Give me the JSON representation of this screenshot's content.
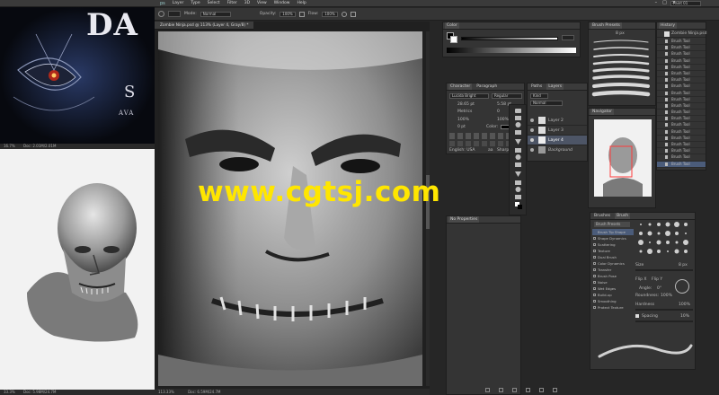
{
  "menubar": {
    "app_mark": "ps",
    "items": [
      "Layer",
      "Type",
      "Select",
      "Filter",
      "3D",
      "View",
      "Window",
      "Help"
    ],
    "workspace": "Paint 01"
  },
  "options": {
    "mode_label": "Mode:",
    "mode_value": "Normal",
    "opacity_label": "Opacity:",
    "opacity_value": "100%",
    "flow_label": "Flow:",
    "flow_value": "100%"
  },
  "doc_top": {
    "title": "Untitled-1.psd @ 16.7% (RGB/8)",
    "art_title": "DA",
    "art_line2": "S",
    "art_line3": "AVA",
    "zoom": "16.7%",
    "doc_size": "Doc: 2.01M/2.01M"
  },
  "doc_bottom": {
    "zoom": "33.3%",
    "doc_size": "Doc: 5.98M/24.7M"
  },
  "main_doc": {
    "title": "Zombie Ninja.psd @ 113% (Layer 4, Gray/8) *",
    "zoom": "113.33%",
    "doc_size": "Doc: 6.59M/24.7M"
  },
  "watermark": "www.cgtsj.com",
  "color_panel": {
    "tabs": [
      "Color"
    ]
  },
  "character_panel": {
    "tabs": [
      "Character",
      "Paragraph"
    ],
    "font_family": "Lucida Bright",
    "font_style": "Regular",
    "font_size": "28.65 pt",
    "leading": "5.58 pt",
    "kerning": "Metrics",
    "tracking": "0",
    "vscale": "100%",
    "hscale": "100%",
    "baseline": "0 pt",
    "color_label": "Color:",
    "language": "English: USA",
    "aa_label": "aa",
    "aa_value": "Sharp"
  },
  "layers_panel": {
    "tabs": [
      "Paths",
      "Layers"
    ],
    "kind": "Kind",
    "blend": "Normal",
    "layers": [
      "Layer 2",
      "Layer 3",
      "Layer 4",
      "Background"
    ]
  },
  "properties_panel": {
    "text": "No Properties"
  },
  "brush_presets_panel": {
    "title": "Brush Presets",
    "size": "8 px"
  },
  "navigator_panel": {
    "title": "Navigator"
  },
  "history_panel": {
    "title": "History",
    "snapshot": "Zombie Ninja.psd",
    "items": [
      "Brush Tool",
      "Brush Tool",
      "Brush Tool",
      "Brush Tool",
      "Brush Tool",
      "Brush Tool",
      "Brush Tool",
      "Brush Tool",
      "Brush Tool",
      "Brush Tool",
      "Brush Tool",
      "Brush Tool",
      "Brush Tool",
      "Brush Tool",
      "Brush Tool",
      "Brush Tool",
      "Brush Tool",
      "Brush Tool",
      "Brush Tool",
      "Brush Tool"
    ]
  },
  "brush_panel": {
    "tabs": [
      "Brushes",
      "Brush"
    ],
    "preset_button": "Brush Presets",
    "options": [
      "Brush Tip Shape",
      "Shape Dynamics",
      "Scattering",
      "Texture",
      "Dual Brush",
      "Color Dynamics",
      "Transfer",
      "Brush Pose",
      "Noise",
      "Wet Edges",
      "Build-up",
      "Smoothing",
      "Protect Texture"
    ],
    "size_label": "Size",
    "size_value": "8 px",
    "flipx": "Flip X",
    "flipy": "Flip Y",
    "angle_label": "Angle:",
    "angle_value": "0°",
    "roundness_label": "Roundness:",
    "roundness_value": "100%",
    "hardness_label": "Hardness",
    "hardness_value": "100%",
    "spacing_label": "Spacing",
    "spacing_value": "10%"
  },
  "colors": {
    "watermark": "#ffe600",
    "panel": "#343434",
    "selected_layer": "#4d5566",
    "history_selected": "#4b5c7a"
  }
}
